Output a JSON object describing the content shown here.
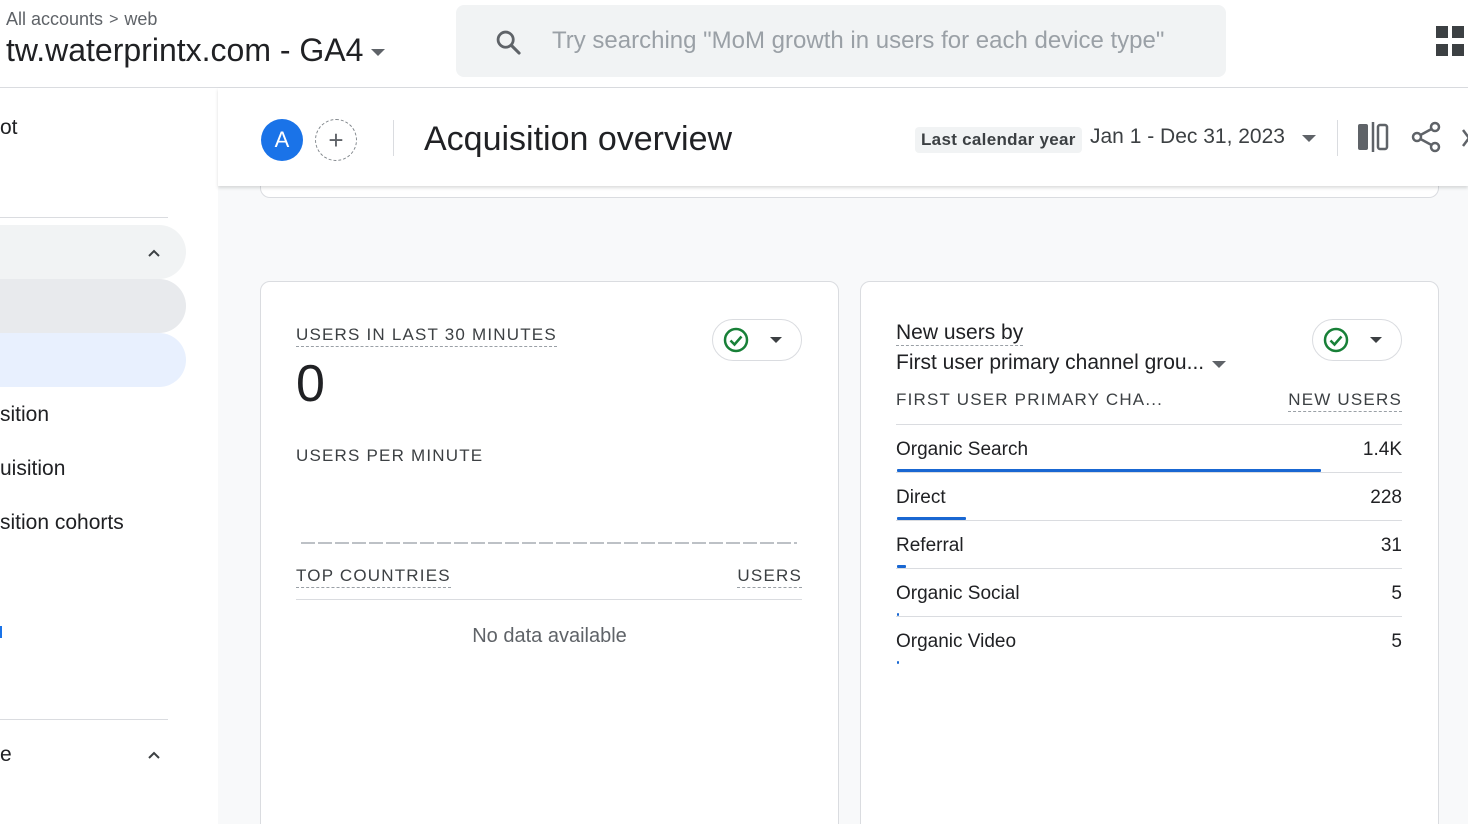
{
  "header": {
    "breadcrumb": {
      "all_accounts": "All accounts",
      "separator": ">",
      "stream": "web"
    },
    "property_name": "tw.waterprintx.com - GA4",
    "search_placeholder": "Try searching \"MoM growth in users for each device type\""
  },
  "sidebar": {
    "items": [
      {
        "label": "ot"
      },
      {
        "label": "sition"
      },
      {
        "label": "uisition"
      },
      {
        "label": "sition cohorts"
      },
      {
        "label": "e"
      }
    ]
  },
  "toolbar": {
    "avatar_letter": "A",
    "add_comparison": "+",
    "page_title": "Acquisition overview",
    "date_preset": "Last calendar year",
    "date_range": "Jan 1 - Dec 31, 2023"
  },
  "realtime_card": {
    "title": "USERS IN LAST 30 MINUTES",
    "value": "0",
    "per_minute_label": "USERS PER MINUTE",
    "table_col1": "TOP COUNTRIES",
    "table_col2": "USERS",
    "empty_text": "No data available"
  },
  "new_users_card": {
    "title": "New users by",
    "dimension": "First user primary channel grou...",
    "col1": "FIRST USER PRIMARY CHA...",
    "col2": "NEW USERS",
    "rows": [
      {
        "label": "Organic Search",
        "value": "1.4K",
        "share": 1.0
      },
      {
        "label": "Direct",
        "value": "228",
        "share": 0.163
      },
      {
        "label": "Referral",
        "value": "31",
        "share": 0.022
      },
      {
        "label": "Organic Social",
        "value": "5",
        "share": 0.004
      },
      {
        "label": "Organic Video",
        "value": "5",
        "share": 0.004
      }
    ]
  },
  "colors": {
    "accent": "#1a73e8",
    "bar": "#1967d2",
    "success": "#188038"
  },
  "icons": [
    "search-icon",
    "apps-grid-icon",
    "chevron-up-icon",
    "compare-icon",
    "share-icon",
    "check-circle-icon",
    "caret-down-icon"
  ]
}
